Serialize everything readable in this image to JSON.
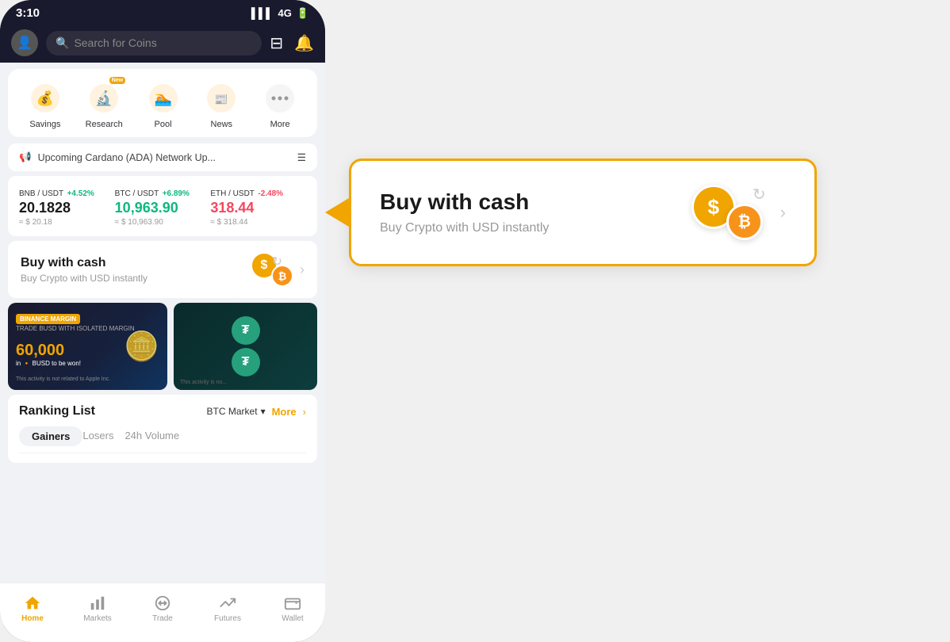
{
  "status_bar": {
    "time": "3:10",
    "signal": "4G",
    "battery": "🔋"
  },
  "search": {
    "placeholder": "Search for Coins"
  },
  "quick_actions": [
    {
      "id": "savings",
      "label": "Savings",
      "icon": "💰",
      "badge": null,
      "color": "#fff3e0"
    },
    {
      "id": "research",
      "label": "Research",
      "icon": "🔬",
      "badge": "New",
      "color": "#fff3e0"
    },
    {
      "id": "pool",
      "label": "Pool",
      "icon": "🏊",
      "badge": null,
      "color": "#fff3e0"
    },
    {
      "id": "news",
      "label": "News",
      "icon": "📰",
      "badge": null,
      "color": "#fff3e0"
    },
    {
      "id": "more",
      "label": "More",
      "icon": "⋯",
      "badge": null,
      "color": "#fff3e0"
    }
  ],
  "announcement": {
    "text": "Upcoming Cardano (ADA) Network Up...",
    "icon": "📢"
  },
  "tickers": [
    {
      "pair": "BNB / USDT",
      "change": "+4.52%",
      "positive": true,
      "price": "20.1828",
      "usd": "≈ $ 20.18"
    },
    {
      "pair": "BTC / USDT",
      "change": "+6.89%",
      "positive": true,
      "price": "10,963.90",
      "usd": "≈ $ 10,963.90"
    },
    {
      "pair": "ETH / USDT",
      "change": "-2.48%",
      "positive": false,
      "price": "318.44",
      "usd": "≈ $ 318.44"
    }
  ],
  "buy_cash": {
    "title": "Buy with cash",
    "subtitle": "Buy Crypto with USD instantly"
  },
  "ranking": {
    "title": "Ranking List",
    "market": "BTC Market",
    "more_label": "More",
    "tabs": [
      "Gainers",
      "Losers",
      "24h Volume"
    ],
    "active_tab": 0
  },
  "bottom_nav": [
    {
      "id": "home",
      "label": "Home",
      "icon": "🏠",
      "active": true
    },
    {
      "id": "markets",
      "label": "Markets",
      "icon": "📊",
      "active": false
    },
    {
      "id": "trade",
      "label": "Trade",
      "icon": "🔄",
      "active": false
    },
    {
      "id": "futures",
      "label": "Futures",
      "icon": "📈",
      "active": false
    },
    {
      "id": "wallet",
      "label": "Wallet",
      "icon": "👛",
      "active": false
    }
  ],
  "tooltip": {
    "title": "Buy with cash",
    "subtitle": "Buy Crypto with USD instantly"
  },
  "banners": [
    {
      "badge": "BINANCE MARGIN",
      "badge2": "TRADE BUSD WITH ISOLATED MARGIN",
      "amount": "60,000",
      "amount_suffix": "in 🔸 BUSD to be won!",
      "disclaimer": "This activity is not related to Apple Inc."
    },
    {
      "disclaimer": "This activity is no..."
    }
  ]
}
